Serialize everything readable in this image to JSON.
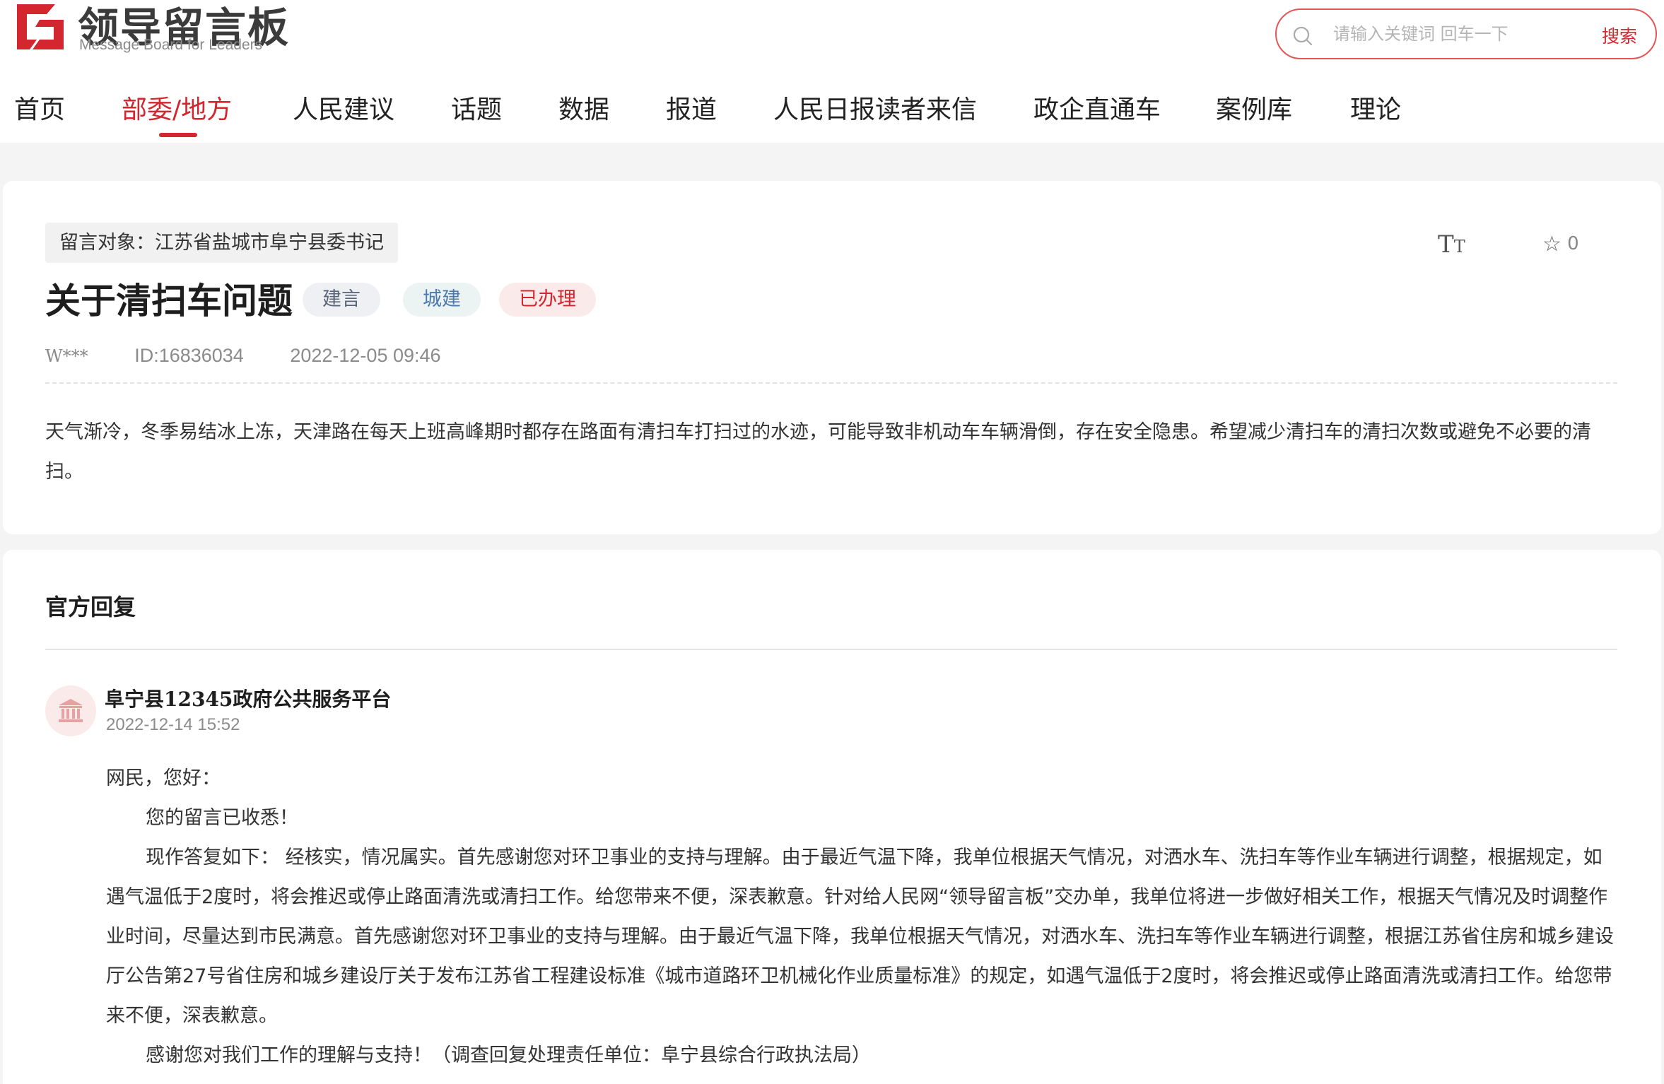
{
  "header": {
    "logo_title": "领导留言板",
    "logo_subtitle": "Message Board for Leaders",
    "search_placeholder": "请输入关键词 回车一下",
    "search_button": "搜索",
    "accent_color": "#d3262e"
  },
  "nav": {
    "items": [
      {
        "label": "首页",
        "active": false
      },
      {
        "label": "部委/地方",
        "active": true
      },
      {
        "label": "人民建议",
        "active": false
      },
      {
        "label": "话题",
        "active": false
      },
      {
        "label": "数据",
        "active": false
      },
      {
        "label": "报道",
        "active": false
      },
      {
        "label": "人民日报读者来信",
        "active": false
      },
      {
        "label": "政企直通车",
        "active": false
      },
      {
        "label": "案例库",
        "active": false
      },
      {
        "label": "理论",
        "active": false
      }
    ]
  },
  "message": {
    "target": "留言对象：江苏省盐城市阜宁县委书记",
    "font_tool": "TT",
    "favorites_count": "0",
    "title": "关于清扫车问题",
    "tags": [
      "建言",
      "城建",
      "已办理"
    ],
    "author": "W***",
    "id": "ID:16836034",
    "datetime": "2022-12-05 09:46",
    "content": "天气渐冷，冬季易结冰上冻，天津路在每天上班高峰期时都存在路面有清扫车打扫过的水迹，可能导致非机动车车辆滑倒，存在安全隐患。希望减少清扫车的清扫次数或避免不必要的清扫。"
  },
  "reply": {
    "heading": "官方回复",
    "org": "阜宁县12345政府公共服务平台",
    "datetime": "2022-12-14 15:52",
    "greeting": "网民，您好：",
    "para1": "您的留言已收悉！",
    "para2": "现作答复如下： 经核实，情况属实。首先感谢您对环卫事业的支持与理解。由于最近气温下降，我单位根据天气情况，对洒水车、洗扫车等作业车辆进行调整，根据规定，如遇气温低于2度时，将会推迟或停止路面清洗或清扫工作。给您带来不便，深表歉意。针对给人民网“领导留言板”交办单，我单位将进一步做好相关工作，根据天气情况及时调整作业时间，尽量达到市民满意。首先感谢您对环卫事业的支持与理解。由于最近气温下降，我单位根据天气情况，对洒水车、洗扫车等作业车辆进行调整，根据江苏省住房和城乡建设厅公告第27号省住房和城乡建设厅关于发布江苏省工程建设标准《城市道路环卫机械化作业质量标准》的规定，如遇气温低于2度时，将会推迟或停止路面清洗或清扫工作。给您带来不便，深表歉意。",
    "para3": "感谢您对我们工作的理解与支持！（调查回复处理责任单位：阜宁县综合行政执法局）"
  }
}
